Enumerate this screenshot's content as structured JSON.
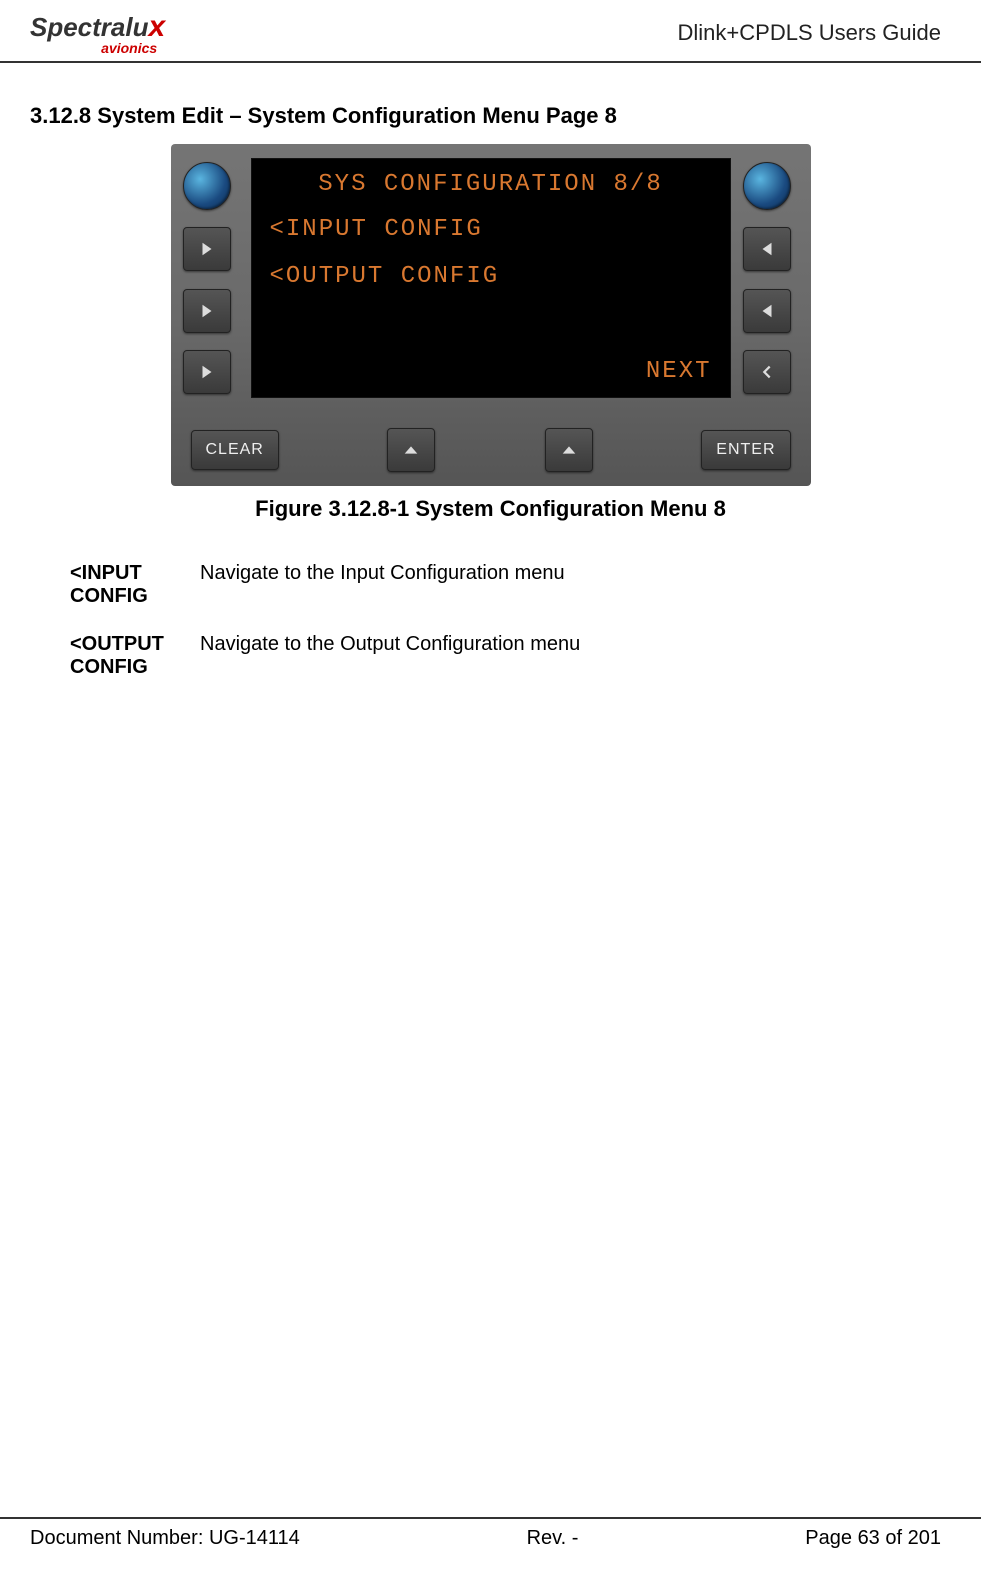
{
  "header": {
    "logo_spectra": "Spectralu",
    "logo_x": "x",
    "logo_avionics": "avionics",
    "title": "Dlink+CPDLS Users Guide"
  },
  "section": {
    "title": "3.12.8 System Edit – System Configuration Menu Page 8"
  },
  "screen": {
    "title": "SYS CONFIGURATION 8/8",
    "line1": "<INPUT CONFIG",
    "line2": "<OUTPUT CONFIG",
    "next": "NEXT"
  },
  "buttons": {
    "clear": "CLEAR",
    "enter": "ENTER"
  },
  "caption": "Figure 3.12.8-1 System Configuration Menu 8",
  "desc": [
    {
      "label": "<INPUT CONFIG",
      "text": "Navigate to the Input Configuration menu"
    },
    {
      "label": "<OUTPUT CONFIG",
      "text": "Navigate to the Output Configuration menu"
    }
  ],
  "footer": {
    "doc": "Document Number:  UG-14114",
    "rev": "Rev. -",
    "page": "Page 63 of 201"
  }
}
